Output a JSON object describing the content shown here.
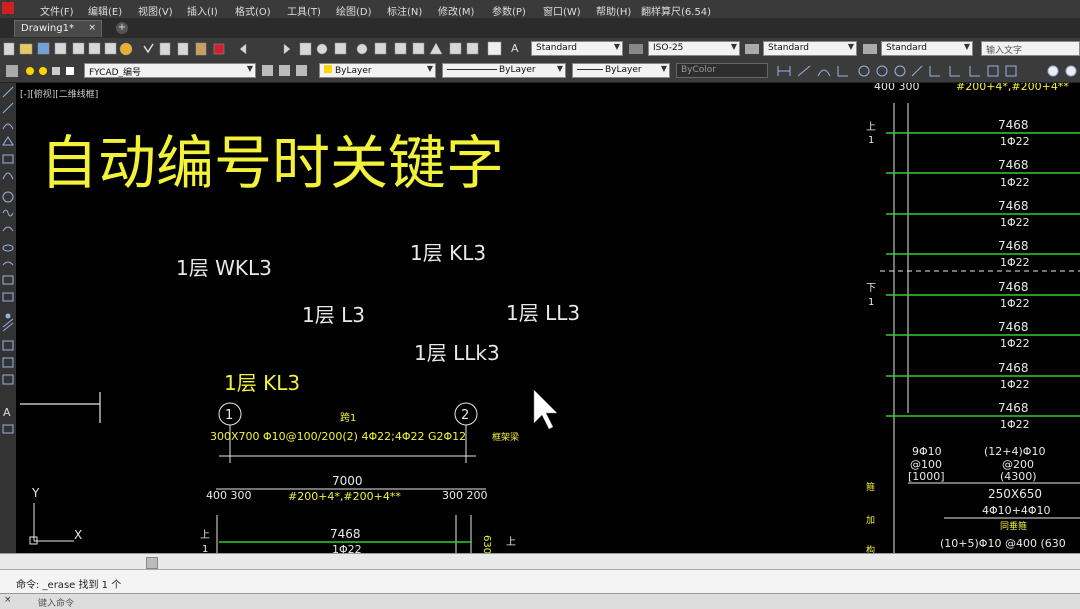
{
  "menu": [
    "文件(F)",
    "编辑(E)",
    "视图(V)",
    "插入(I)",
    "格式(O)",
    "工具(T)",
    "绘图(D)",
    "标注(N)",
    "修改(M)",
    "参数(P)",
    "窗口(W)",
    "帮助(H)",
    "翻样算尺(6.54)"
  ],
  "tabs": {
    "active": "Drawing1*",
    "new": "+"
  },
  "toolbar1": {
    "text_style": "Standard",
    "dim_style": "ISO-25",
    "table_style": "Standard",
    "multileader_style": "Standard",
    "search_placeholder": "输入文字"
  },
  "toolbar2": {
    "layer": "FYCAD_编号",
    "color": "ByLayer",
    "linetype": "ByLayer",
    "lineweight": "ByLayer",
    "plotstyle": "ByColor"
  },
  "viewport_label": "[-][俯视][二维线框]",
  "canvas": {
    "headline": "自动编号时关键字",
    "labels": [
      "1层 KL3",
      "1层 WKL3",
      "1层 L3",
      "1层 LL3",
      "1层 LLk3",
      "1层 KL3"
    ],
    "beam": {
      "grid_a": "1",
      "grid_b": "2",
      "span_label": "跨1",
      "spec": "300X700 Φ10@100/200(2) 4Φ22;4Φ22 G2Φ12",
      "tag": "框架梁",
      "length": "7000",
      "left_support": "400 300",
      "right_support": "300 200",
      "bars": "#200+4*,#200+4**",
      "bottom_len": "7468",
      "bottom_bar": "1Φ22",
      "side_up": "上",
      "side_one": "1",
      "bottom_right_up": "上",
      "vert_num": "630"
    },
    "ucs": {
      "y": "Y",
      "x": "X"
    },
    "right_panel": {
      "top_text_left": "400 300",
      "top_text_right": "#200+4*,#200+4**",
      "up_label": "上",
      "down_label": "下",
      "one": "1",
      "rows": [
        {
          "len": "7468",
          "bar": "1Φ22"
        },
        {
          "len": "7468",
          "bar": "1Φ22"
        },
        {
          "len": "7468",
          "bar": "1Φ22"
        },
        {
          "len": "7468",
          "bar": "1Φ22"
        },
        {
          "len": "7468",
          "bar": "1Φ22"
        },
        {
          "len": "7468",
          "bar": "1Φ22"
        },
        {
          "len": "7468",
          "bar": "1Φ22"
        },
        {
          "len": "7468",
          "bar": "1Φ22"
        }
      ],
      "stirrup_left_1": "9Φ10",
      "stirrup_left_2": "@100",
      "stirrup_left_3": "[1000]",
      "stirrup_mid_1": "(12+4)Φ10",
      "stirrup_mid_2": "@200",
      "stirrup_mid_3": "(4300)",
      "section": "250X650",
      "section_bars": "4Φ10+4Φ10",
      "same_note": "同垂箍",
      "bottom_row": "(10+5)Φ10 @400 (630",
      "vert_chars": [
        "箍",
        "加",
        "构"
      ]
    }
  },
  "command": {
    "history": "命令: _erase 找到 1 个",
    "prompt": "键入命令"
  },
  "colors": {
    "yellow": "#f2f23a",
    "green": "#33cc33",
    "white": "#e8e8e8",
    "accent": "#ffd400"
  }
}
